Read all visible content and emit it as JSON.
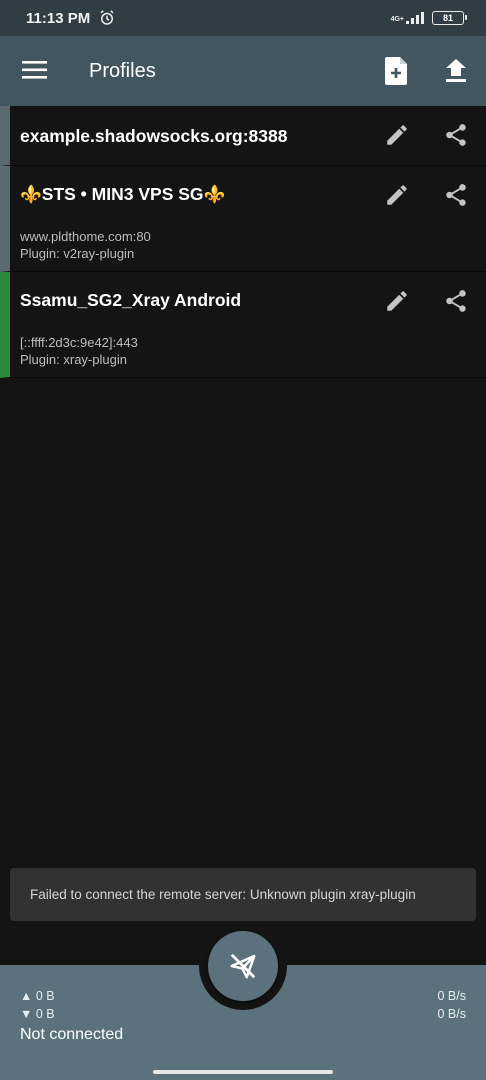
{
  "status_bar": {
    "time": "11:13 PM",
    "network": "4G+",
    "battery": "81"
  },
  "app_bar": {
    "title": "Profiles"
  },
  "profiles": [
    {
      "name": "example.shadowsocks.org:8388",
      "server": "",
      "plugin": "",
      "active": false
    },
    {
      "name": "⚜️STS • MIN3 VPS SG⚜️",
      "server": "www.pldthome.com:80",
      "plugin": "Plugin: v2ray-plugin",
      "active": false
    },
    {
      "name": "Ssamu_SG2_Xray Android",
      "server": "[::ffff:2d3c:9e42]:443",
      "plugin": "Plugin: xray-plugin",
      "active": true
    }
  ],
  "snackbar": {
    "message": "Failed to connect the remote server: Unknown plugin xray-plugin"
  },
  "bottom_bar": {
    "tx_total": "▲ 0 B",
    "rx_total": "▼ 0 B",
    "tx_rate": "0 B/s",
    "rx_rate": "0 B/s",
    "status": "Not connected"
  },
  "colors": {
    "app_bar": "#435660",
    "status_bar": "#303d45",
    "bottom_bar": "#5b717c",
    "active_indicator": "#2d8a3a",
    "background": "#141414"
  },
  "icons": {
    "menu": "hamburger-menu-icon",
    "add": "add-file-icon",
    "upload": "upload-icon",
    "edit": "pencil-icon",
    "share": "share-icon",
    "fab": "paper-plane-off-icon"
  }
}
